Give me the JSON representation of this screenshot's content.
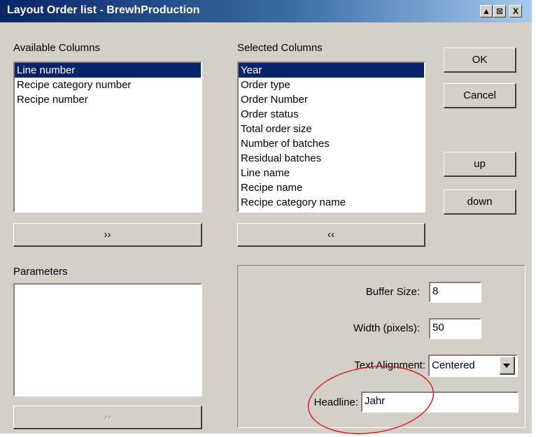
{
  "window": {
    "title": "Layout Order list - BrewhProduction",
    "minimize_glyph": "▲",
    "restore_glyph": "⊠",
    "close_glyph": "X"
  },
  "available": {
    "label": "Available Columns",
    "items": [
      "Line number",
      "Recipe category number",
      "Recipe number"
    ],
    "add_button": "››"
  },
  "selected": {
    "label": "Selected Columns",
    "items": [
      "Year",
      "Order type",
      "Order Number",
      "Order status",
      "Total order size",
      "Number of batches",
      "Residual batches",
      "Line name",
      "Recipe name",
      "Recipe category name"
    ],
    "remove_button": "‹‹"
  },
  "buttons": {
    "ok": "OK",
    "cancel": "Cancel",
    "up": "up",
    "down": "down"
  },
  "parameters": {
    "label": "Parameters",
    "add_button": "››"
  },
  "properties": {
    "buffer_size_label": "Buffer Size:",
    "buffer_size_value": "8",
    "width_label": "Width (pixels):",
    "width_value": "50",
    "alignment_label": "Text Alignment:",
    "alignment_value": "Centered",
    "headline_label": "Headline:",
    "headline_value": "Jahr"
  },
  "colors": {
    "annotation_ellipse": "#e02020",
    "selection": "#0a246a",
    "face": "#d4d0c8"
  }
}
